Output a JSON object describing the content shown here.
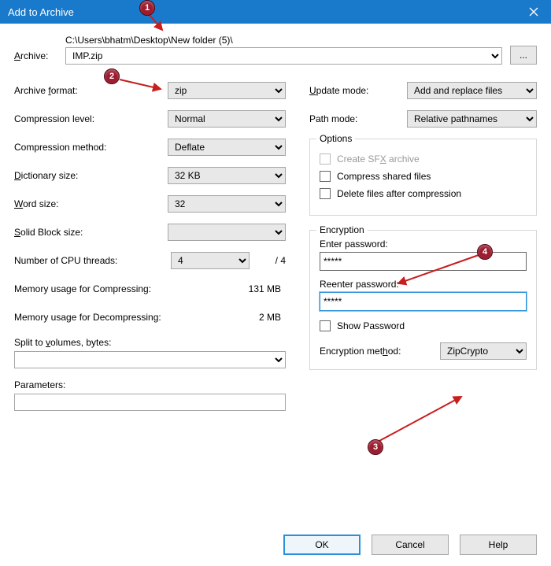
{
  "title": "Add to Archive",
  "archive": {
    "label": "Archive:",
    "path": "C:\\Users\\bhatm\\Desktop\\New folder (5)\\",
    "filename": "IMP.zip",
    "browse": "..."
  },
  "left": {
    "format_label": "Archive format:",
    "format_value": "zip",
    "level_label": "Compression level:",
    "level_value": "Normal",
    "method_label": "Compression method:",
    "method_value": "Deflate",
    "dict_label": "Dictionary size:",
    "dict_value": "32 KB",
    "word_label": "Word size:",
    "word_value": "32",
    "solid_label": "Solid Block size:",
    "solid_value": "",
    "cpu_label": "Number of CPU threads:",
    "cpu_value": "4",
    "cpu_total": "/ 4",
    "mem_compress_label": "Memory usage for Compressing:",
    "mem_compress_value": "131 MB",
    "mem_decompress_label": "Memory usage for Decompressing:",
    "mem_decompress_value": "2 MB",
    "split_label": "Split to volumes, bytes:",
    "params_label": "Parameters:"
  },
  "right": {
    "update_label": "Update mode:",
    "update_value": "Add and replace files",
    "pathmode_label": "Path mode:",
    "pathmode_value": "Relative pathnames",
    "options_title": "Options",
    "sfx_label": "Create SFX archive",
    "compress_shared_label": "Compress shared files",
    "delete_after_label": "Delete files after compression",
    "encryption_title": "Encryption",
    "enter_pw_label": "Enter password:",
    "enter_pw_value": "*****",
    "reenter_pw_label": "Reenter password:",
    "reenter_pw_value": "*****",
    "show_pw_label": "Show Password",
    "enc_method_label": "Encryption method:",
    "enc_method_value": "ZipCrypto"
  },
  "footer": {
    "ok": "OK",
    "cancel": "Cancel",
    "help": "Help"
  },
  "badges": {
    "b1": "1",
    "b2": "2",
    "b3": "3",
    "b4": "4"
  }
}
